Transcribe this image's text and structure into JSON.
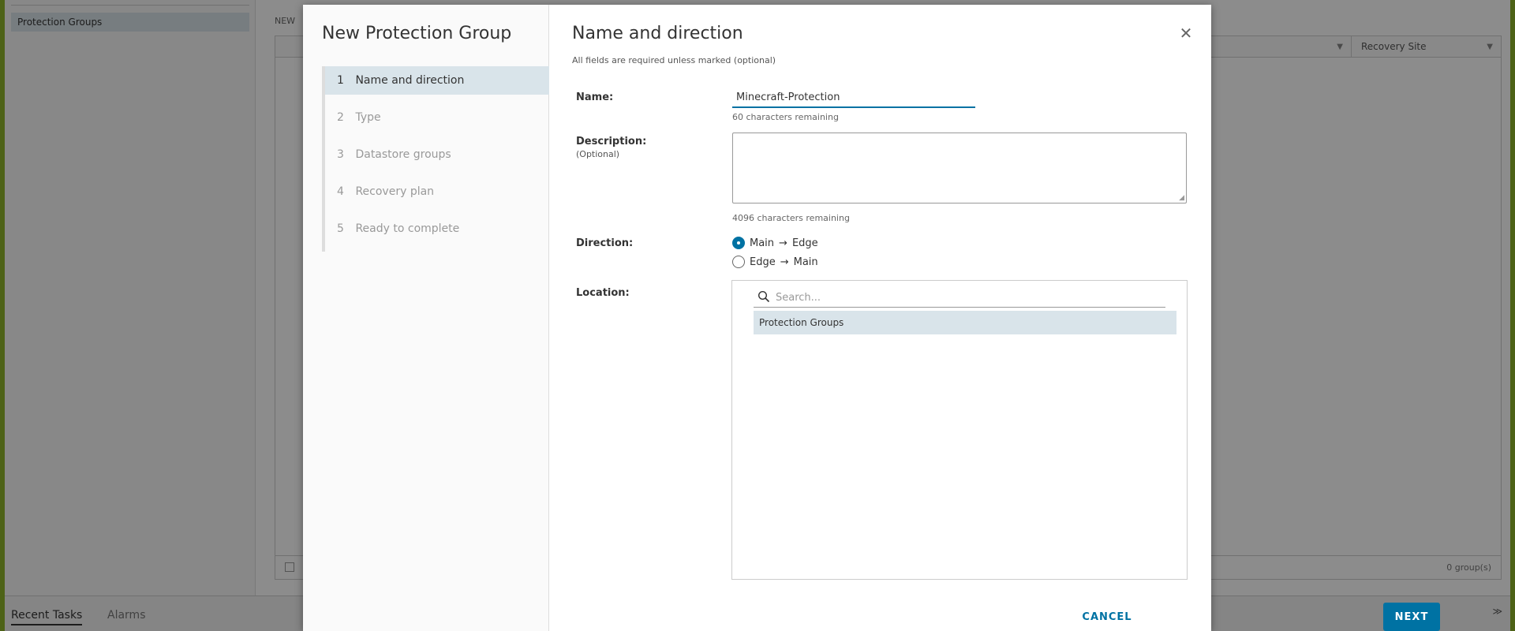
{
  "background": {
    "sidebar_item": "Protection Groups",
    "toolbar_label": "NEW",
    "grid_columns": [
      "",
      "Recovery Site"
    ],
    "grid_footer_count": "0 group(s)",
    "bottom_tabs": [
      "Recent Tasks",
      "Alarms"
    ]
  },
  "wizard": {
    "title": "New Protection Group",
    "steps": [
      {
        "num": "1",
        "label": "Name and direction",
        "active": true
      },
      {
        "num": "2",
        "label": "Type",
        "active": false
      },
      {
        "num": "3",
        "label": "Datastore groups",
        "active": false
      },
      {
        "num": "4",
        "label": "Recovery plan",
        "active": false
      },
      {
        "num": "5",
        "label": "Ready to complete",
        "active": false
      }
    ]
  },
  "page": {
    "heading": "Name and direction",
    "required_note": "All fields are required unless marked (optional)",
    "name_label": "Name:",
    "name_value": "Minecraft-Protection",
    "name_helper": "60 characters remaining",
    "description_label": "Description:",
    "description_optional": "(Optional)",
    "description_value": "",
    "description_helper": "4096 characters remaining",
    "direction_label": "Direction:",
    "direction_options": [
      {
        "from": "Main",
        "to": "Edge",
        "selected": true
      },
      {
        "from": "Edge",
        "to": "Main",
        "selected": false
      }
    ],
    "arrow": "→",
    "location_label": "Location:",
    "search_placeholder": "Search...",
    "location_items": [
      "Protection Groups"
    ]
  },
  "footer": {
    "cancel_label": "CANCEL",
    "next_label": "NEXT"
  },
  "colors": {
    "accent": "#0072a3",
    "selected_row": "#d9e4ea",
    "desktop": "#8cb22a"
  }
}
